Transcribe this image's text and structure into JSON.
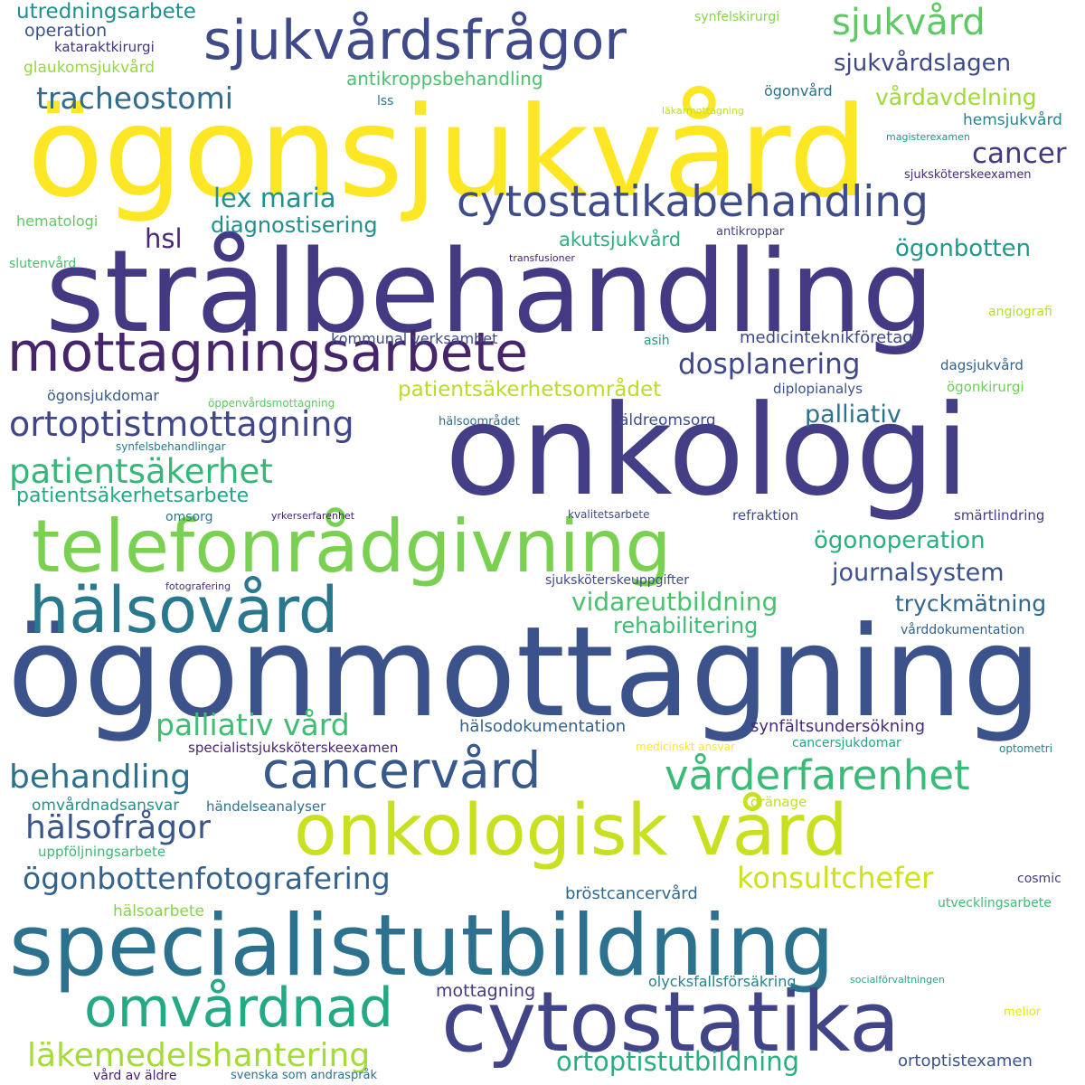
{
  "words": [
    {
      "text": "ögonmottagning",
      "color": "#3b528b"
    },
    {
      "text": "strålbehandling",
      "color": "#443983"
    },
    {
      "text": "ögonsjukvård",
      "color": "#fde725"
    },
    {
      "text": "onkologi",
      "color": "#433e85"
    },
    {
      "text": "specialistutbildning",
      "color": "#2c728e"
    },
    {
      "text": "telefonrådgivning",
      "color": "#7ad151"
    },
    {
      "text": "cytostatika",
      "color": "#414487"
    },
    {
      "text": "onkologisk vård",
      "color": "#c8e020"
    },
    {
      "text": "hälsovård",
      "color": "#2a788e"
    },
    {
      "text": "mottagningsarbete",
      "color": "#46256b"
    },
    {
      "text": "sjukvårdsfrågor",
      "color": "#3e4a89"
    },
    {
      "text": "cytostatikabehandling",
      "color": "#3e4c8a"
    },
    {
      "text": "cancervård",
      "color": "#38598c"
    },
    {
      "text": "omvårdnad",
      "color": "#23a983"
    },
    {
      "text": "vårderfarenhet",
      "color": "#3aba76"
    },
    {
      "text": "ortoptistmottagning",
      "color": "#404688"
    },
    {
      "text": "tracheostomi",
      "color": "#2f6c8e"
    },
    {
      "text": "patientsäkerhet",
      "color": "#35b779"
    },
    {
      "text": "hälsofrågor",
      "color": "#39568c"
    },
    {
      "text": "ögonbottenfotografering",
      "color": "#33638d"
    },
    {
      "text": "läkemedelshantering",
      "color": "#a5db36"
    },
    {
      "text": "behandling",
      "color": "#2d708e"
    },
    {
      "text": "palliativ vård",
      "color": "#40bd72"
    },
    {
      "text": "sjukvård",
      "color": "#5ec962"
    },
    {
      "text": "konsultchefer",
      "color": "#cde11d"
    },
    {
      "text": "dosplanering",
      "color": "#3f4788"
    },
    {
      "text": "ortoptistutbildning",
      "color": "#28ae80"
    },
    {
      "text": "patientsäkerhetsarbete",
      "color": "#22a884"
    },
    {
      "text": "vidareutbildning",
      "color": "#4ac16d"
    },
    {
      "text": "journalsystem",
      "color": "#3b528b"
    },
    {
      "text": "lex maria",
      "color": "#20928c"
    },
    {
      "text": "cancer",
      "color": "#453781"
    },
    {
      "text": "sjukvårdslagen",
      "color": "#3e4989"
    },
    {
      "text": "ögonoperation",
      "color": "#2ab07f"
    },
    {
      "text": "patientsäkerhetsområdet",
      "color": "#b8de29"
    },
    {
      "text": "palliativ",
      "color": "#2c728e"
    },
    {
      "text": "tryckmätning",
      "color": "#31688e"
    },
    {
      "text": "ögonbotten",
      "color": "#1f9a8a"
    },
    {
      "text": "rehabilitering",
      "color": "#3dbc74"
    },
    {
      "text": "diagnostisering",
      "color": "#21908d"
    },
    {
      "text": "hsl",
      "color": "#482878"
    },
    {
      "text": "vårdavdelning",
      "color": "#a0da39"
    },
    {
      "text": "akutsjukvård",
      "color": "#2ab07f"
    },
    {
      "text": "utredningsarbete",
      "color": "#218f8d"
    },
    {
      "text": "antikroppsbehandling",
      "color": "#4ac16d"
    },
    {
      "text": "medicinteknikföretag",
      "color": "#3e4989"
    },
    {
      "text": "synfältsundersökning",
      "color": "#472c7a"
    },
    {
      "text": "hälsodokumentation",
      "color": "#33638d"
    },
    {
      "text": "bröstcancervård",
      "color": "#31688e"
    },
    {
      "text": "olycksfallsförsäkring",
      "color": "#26828e"
    },
    {
      "text": "ortoptistexamen",
      "color": "#3b528b"
    },
    {
      "text": "mottagning",
      "color": "#443a83"
    },
    {
      "text": "specialistsjuksköterskeexamen",
      "color": "#482475"
    },
    {
      "text": "kommunal verksamhet",
      "color": "#3e4c8a"
    },
    {
      "text": "omvårdnadsansvar",
      "color": "#20928c"
    },
    {
      "text": "operation",
      "color": "#3b528b"
    },
    {
      "text": "glaukomsjukvård",
      "color": "#95d840"
    },
    {
      "text": "ögonsjukdomar",
      "color": "#38598c"
    },
    {
      "text": "dagsjukvård",
      "color": "#33638d"
    },
    {
      "text": "ögonkirurgi",
      "color": "#6ece58"
    },
    {
      "text": "hemsjukvård",
      "color": "#25848e"
    },
    {
      "text": "hematologi",
      "color": "#5ec962"
    },
    {
      "text": "uppföljningsarbete",
      "color": "#3aba76"
    },
    {
      "text": "händelseanalyser",
      "color": "#2c728e"
    },
    {
      "text": "hälsoarbete",
      "color": "#86d549"
    },
    {
      "text": "sjuksköterskeuppgifter",
      "color": "#3e4a89"
    },
    {
      "text": "smärtlindring",
      "color": "#433e85"
    },
    {
      "text": "diplopianalys",
      "color": "#3b528b"
    },
    {
      "text": "refraktion",
      "color": "#3e4989"
    },
    {
      "text": "äldreomsorg",
      "color": "#3e4c8a"
    },
    {
      "text": "ögonvård",
      "color": "#2c728e"
    },
    {
      "text": "kataraktkirurgi",
      "color": "#46337f"
    },
    {
      "text": "cancersjukdomar",
      "color": "#21a685"
    },
    {
      "text": "vårddokumentation",
      "color": "#33638d"
    },
    {
      "text": "cosmic",
      "color": "#433e85"
    },
    {
      "text": "angiografi",
      "color": "#b5de2b"
    },
    {
      "text": "utvecklingsarbete",
      "color": "#3dbc74"
    },
    {
      "text": "vård av äldre",
      "color": "#481f70"
    },
    {
      "text": "svenska som andraspråk",
      "color": "#2c728e"
    },
    {
      "text": "sjuksköterskeexamen",
      "color": "#482878"
    },
    {
      "text": "asih",
      "color": "#1f9a8a"
    },
    {
      "text": "lss",
      "color": "#2a788e"
    },
    {
      "text": "omsorg",
      "color": "#2a788e"
    },
    {
      "text": "slutenvård",
      "color": "#4ac16d"
    },
    {
      "text": "synfelskirurgi",
      "color": "#86d549"
    },
    {
      "text": "antikroppar",
      "color": "#414487"
    },
    {
      "text": "hälsoområdet",
      "color": "#2f6c8e"
    },
    {
      "text": "synfelsbehandlingar",
      "color": "#2a788e"
    },
    {
      "text": "öppenvårdsmottagning",
      "color": "#5ec962"
    },
    {
      "text": "medicinskt ansvar",
      "color": "#fde725"
    },
    {
      "text": "dränage",
      "color": "#c0df25"
    },
    {
      "text": "optometri",
      "color": "#26828e"
    },
    {
      "text": "socialförvaltningen",
      "color": "#22a884"
    },
    {
      "text": "melior",
      "color": "#e5e419"
    },
    {
      "text": "kvalitetsarbete",
      "color": "#3e4989"
    },
    {
      "text": "yrkerserfarenhet",
      "color": "#482475"
    },
    {
      "text": "fotografering",
      "color": "#46307e"
    },
    {
      "text": "läkarmottagning",
      "color": "#bddf26"
    },
    {
      "text": "magisterexamen",
      "color": "#20928c"
    },
    {
      "text": "transfusioner",
      "color": "#482173"
    }
  ]
}
